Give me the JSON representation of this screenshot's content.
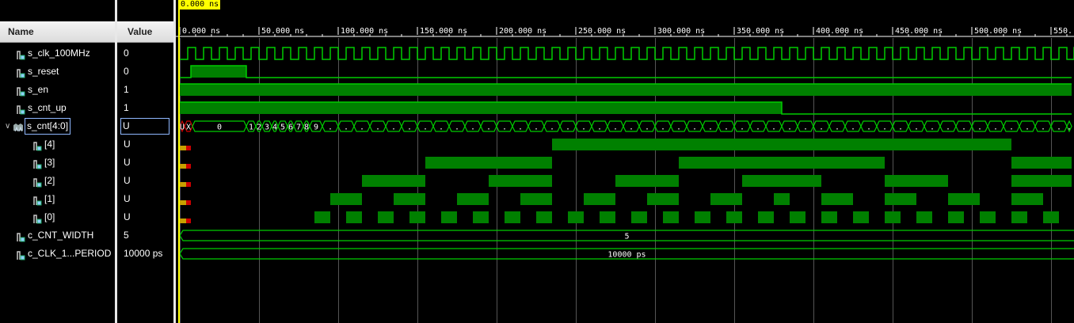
{
  "cursor": {
    "label": "0.000 ns"
  },
  "columns": {
    "name": "Name",
    "value": "Value"
  },
  "timeline": {
    "unit": "ns",
    "ticks": [
      "0.000 ns",
      "50.000 ns",
      "100.000 ns",
      "150.000 ns",
      "200.000 ns",
      "250.000 ns",
      "300.000 ns",
      "350.000 ns",
      "400.000 ns",
      "450.000 ns",
      "500.000 ns",
      "550."
    ],
    "span_ns": 563
  },
  "colors": {
    "wave": "#00cc00",
    "fill": "#008000",
    "unknown": "#cc0000",
    "cursor": "#ffff00",
    "grid": "#555555"
  },
  "signals": [
    {
      "name": "s_clk_100MHz",
      "value": "0",
      "icon": "signal-icon",
      "indent": 0
    },
    {
      "name": "s_reset",
      "value": "0",
      "icon": "signal-icon",
      "indent": 0
    },
    {
      "name": "s_en",
      "value": "1",
      "icon": "signal-icon",
      "indent": 0
    },
    {
      "name": "s_cnt_up",
      "value": "1",
      "icon": "signal-icon",
      "indent": 0
    },
    {
      "name": "s_cnt[4:0]",
      "value": "U",
      "icon": "bus-icon",
      "indent": 0,
      "expanded": true
    },
    {
      "name": "[4]",
      "value": "U",
      "icon": "signal-icon",
      "indent": 1
    },
    {
      "name": "[3]",
      "value": "U",
      "icon": "signal-icon",
      "indent": 1
    },
    {
      "name": "[2]",
      "value": "U",
      "icon": "signal-icon",
      "indent": 1
    },
    {
      "name": "[1]",
      "value": "U",
      "icon": "signal-icon",
      "indent": 1
    },
    {
      "name": "[0]",
      "value": "U",
      "icon": "signal-icon",
      "indent": 1
    },
    {
      "name": "c_CNT_WIDTH",
      "value": "5",
      "icon": "signal-icon",
      "indent": 0
    },
    {
      "name": "c_CLK_1...PERIOD",
      "value": "10000 ps",
      "icon": "signal-icon",
      "indent": 0
    }
  ],
  "waves": {
    "s_reset": [
      [
        0,
        "0"
      ],
      [
        7,
        "1"
      ],
      [
        42,
        "0"
      ]
    ],
    "s_en": [
      [
        0,
        "1"
      ]
    ],
    "s_cnt_up": [
      [
        0,
        "1"
      ],
      [
        380,
        "0"
      ]
    ],
    "bus_labels": [
      [
        0,
        "U"
      ],
      [
        3,
        "X"
      ],
      [
        8,
        "0"
      ],
      [
        42,
        "1"
      ],
      [
        48,
        "2"
      ],
      [
        52,
        "3"
      ],
      [
        58,
        "4"
      ],
      [
        62,
        "5"
      ],
      [
        68,
        "6"
      ],
      [
        72,
        "7"
      ],
      [
        78,
        "8"
      ],
      [
        82,
        "9"
      ]
    ],
    "bits": {
      "4": [
        [
          0,
          "U"
        ],
        [
          7,
          "0"
        ],
        [
          235,
          "1"
        ],
        [
          525,
          "0"
        ]
      ],
      "3": [
        [
          0,
          "U"
        ],
        [
          7,
          "0"
        ],
        [
          155,
          "1"
        ],
        [
          235,
          "0"
        ],
        [
          315,
          "1"
        ],
        [
          445,
          "0"
        ],
        [
          525,
          "1"
        ]
      ],
      "2": [
        [
          0,
          "U"
        ],
        [
          7,
          "0"
        ],
        [
          115,
          "1"
        ],
        [
          155,
          "0"
        ],
        [
          195,
          "1"
        ],
        [
          235,
          "0"
        ],
        [
          275,
          "1"
        ],
        [
          315,
          "0"
        ],
        [
          355,
          "1"
        ],
        [
          405,
          "0"
        ],
        [
          445,
          "1"
        ],
        [
          485,
          "0"
        ],
        [
          525,
          "1"
        ]
      ],
      "1": [
        [
          0,
          "U"
        ],
        [
          7,
          "0"
        ],
        [
          95,
          "1"
        ],
        [
          115,
          "0"
        ],
        [
          135,
          "1"
        ],
        [
          155,
          "0"
        ],
        [
          175,
          "1"
        ],
        [
          195,
          "0"
        ],
        [
          215,
          "1"
        ],
        [
          235,
          "0"
        ],
        [
          255,
          "1"
        ],
        [
          275,
          "0"
        ],
        [
          295,
          "1"
        ],
        [
          315,
          "0"
        ],
        [
          335,
          "1"
        ],
        [
          355,
          "0"
        ],
        [
          375,
          "1"
        ],
        [
          385,
          "0"
        ],
        [
          405,
          "1"
        ],
        [
          425,
          "0"
        ],
        [
          445,
          "1"
        ],
        [
          465,
          "0"
        ],
        [
          485,
          "1"
        ],
        [
          505,
          "0"
        ],
        [
          525,
          "1"
        ],
        [
          545,
          "0"
        ]
      ],
      "0": [
        [
          0,
          "U"
        ],
        [
          7,
          "0"
        ],
        [
          85,
          "1"
        ],
        [
          95,
          "0"
        ],
        [
          105,
          "1"
        ],
        [
          115,
          "0"
        ],
        [
          125,
          "1"
        ],
        [
          135,
          "0"
        ],
        [
          145,
          "1"
        ],
        [
          155,
          "0"
        ],
        [
          165,
          "1"
        ],
        [
          175,
          "0"
        ],
        [
          185,
          "1"
        ],
        [
          195,
          "0"
        ],
        [
          205,
          "1"
        ],
        [
          215,
          "0"
        ],
        [
          225,
          "1"
        ],
        [
          235,
          "0"
        ],
        [
          245,
          "1"
        ],
        [
          255,
          "0"
        ],
        [
          265,
          "1"
        ],
        [
          275,
          "0"
        ],
        [
          285,
          "1"
        ],
        [
          295,
          "0"
        ],
        [
          305,
          "1"
        ],
        [
          315,
          "0"
        ],
        [
          325,
          "1"
        ],
        [
          335,
          "0"
        ],
        [
          345,
          "1"
        ],
        [
          355,
          "0"
        ],
        [
          365,
          "1"
        ],
        [
          375,
          "0"
        ],
        [
          385,
          "1"
        ],
        [
          395,
          "0"
        ],
        [
          405,
          "1"
        ],
        [
          415,
          "0"
        ],
        [
          425,
          "1"
        ],
        [
          435,
          "0"
        ],
        [
          445,
          "1"
        ],
        [
          455,
          "0"
        ],
        [
          465,
          "1"
        ],
        [
          475,
          "0"
        ],
        [
          485,
          "1"
        ],
        [
          495,
          "0"
        ],
        [
          505,
          "1"
        ],
        [
          515,
          "0"
        ],
        [
          525,
          "1"
        ],
        [
          535,
          "0"
        ],
        [
          545,
          "1"
        ],
        [
          555,
          "0"
        ]
      ]
    },
    "consts": {
      "c_CNT_WIDTH": "5",
      "c_CLK_PERIOD": "10000 ps"
    }
  }
}
